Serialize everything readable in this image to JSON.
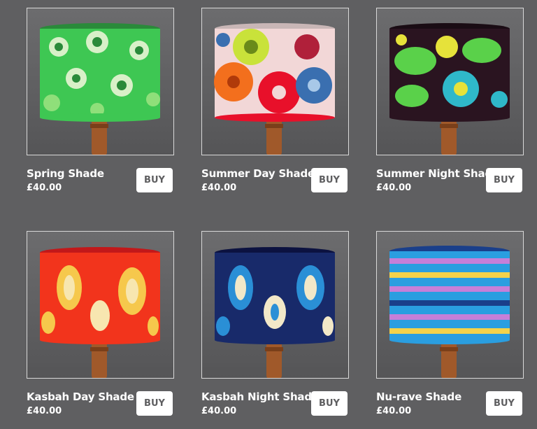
{
  "products": [
    {
      "name": "Spring Shade",
      "price": "£40.00",
      "buy_label": "BUY",
      "colors": {
        "base": "#3ec753",
        "accent1": "#d8f0c8",
        "accent2": "#8fdf7a",
        "accent3": "#2a8a3a"
      }
    },
    {
      "name": "Summer Day Shade",
      "price": "£40.00",
      "buy_label": "BUY",
      "colors": {
        "base": "#f2d7d7",
        "accent1": "#f36f1d",
        "accent2": "#e8102a",
        "accent3": "#3a6fb0"
      }
    },
    {
      "name": "Summer Night Shade",
      "price": "£40.00",
      "buy_label": "BUY",
      "colors": {
        "base": "#2a1420",
        "accent1": "#5ad14a",
        "accent2": "#2fb8c9",
        "accent3": "#e6e23a"
      }
    },
    {
      "name": "Kasbah Day Shade",
      "price": "£40.00",
      "buy_label": "BUY",
      "colors": {
        "base": "#f2341c",
        "accent1": "#f6c84c",
        "accent2": "#f7e6b0",
        "accent3": "#c2181a"
      }
    },
    {
      "name": "Kasbah Night Shade",
      "price": "£40.00",
      "buy_label": "BUY",
      "colors": {
        "base": "#182a6a",
        "accent1": "#2a8fd6",
        "accent2": "#f2e8c8",
        "accent3": "#0c1240"
      }
    },
    {
      "name": "Nu-rave Shade",
      "price": "£40.00",
      "buy_label": "BUY",
      "colors": {
        "base": "#2a9ee0",
        "accent1": "#c67fd8",
        "accent2": "#f4d24a",
        "accent3": "#1a3f8a"
      }
    }
  ]
}
